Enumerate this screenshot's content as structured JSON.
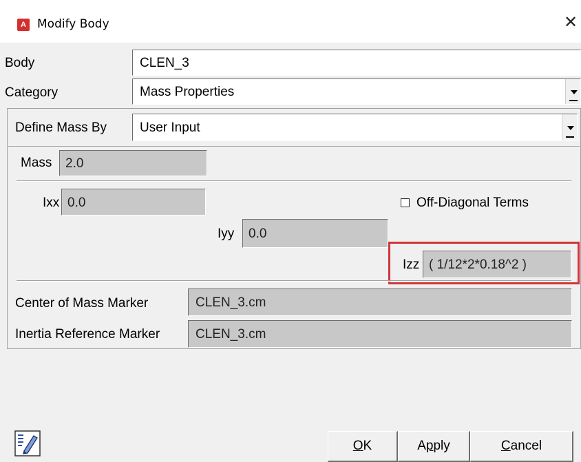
{
  "window": {
    "title": "Modify Body",
    "app_icon_letter": "A"
  },
  "form": {
    "body_label": "Body",
    "body_value": "CLEN_3",
    "category_label": "Category",
    "category_value": "Mass Properties",
    "define_label": "Define Mass By",
    "define_value": "User Input",
    "mass_label": "Mass",
    "mass_value": "2.0",
    "ixx_label": "Ixx",
    "ixx_value": "0.0",
    "offdiag_label": "Off-Diagonal Terms",
    "offdiag_checked": false,
    "iyy_label": "Iyy",
    "iyy_value": "0.0",
    "izz_label": "Izz",
    "izz_value": "( 1/12*2*0.18^2 )",
    "com_label": "Center of Mass Marker",
    "com_value": "CLEN_3.cm",
    "irm_label": "Inertia Reference Marker",
    "irm_value": "CLEN_3.cm"
  },
  "buttons": {
    "ok_mnemonic": "O",
    "ok_rest": "K",
    "apply_first": "A",
    "apply_mnemonic": "p",
    "apply_rest": "ply",
    "cancel_mnemonic": "C",
    "cancel_rest": "ancel"
  },
  "colors": {
    "highlight": "#d0343a",
    "app_icon": "#d32f2f"
  },
  "icons": [
    "app-icon",
    "close-icon",
    "combo-arrow-icon",
    "edit-notes-icon"
  ]
}
